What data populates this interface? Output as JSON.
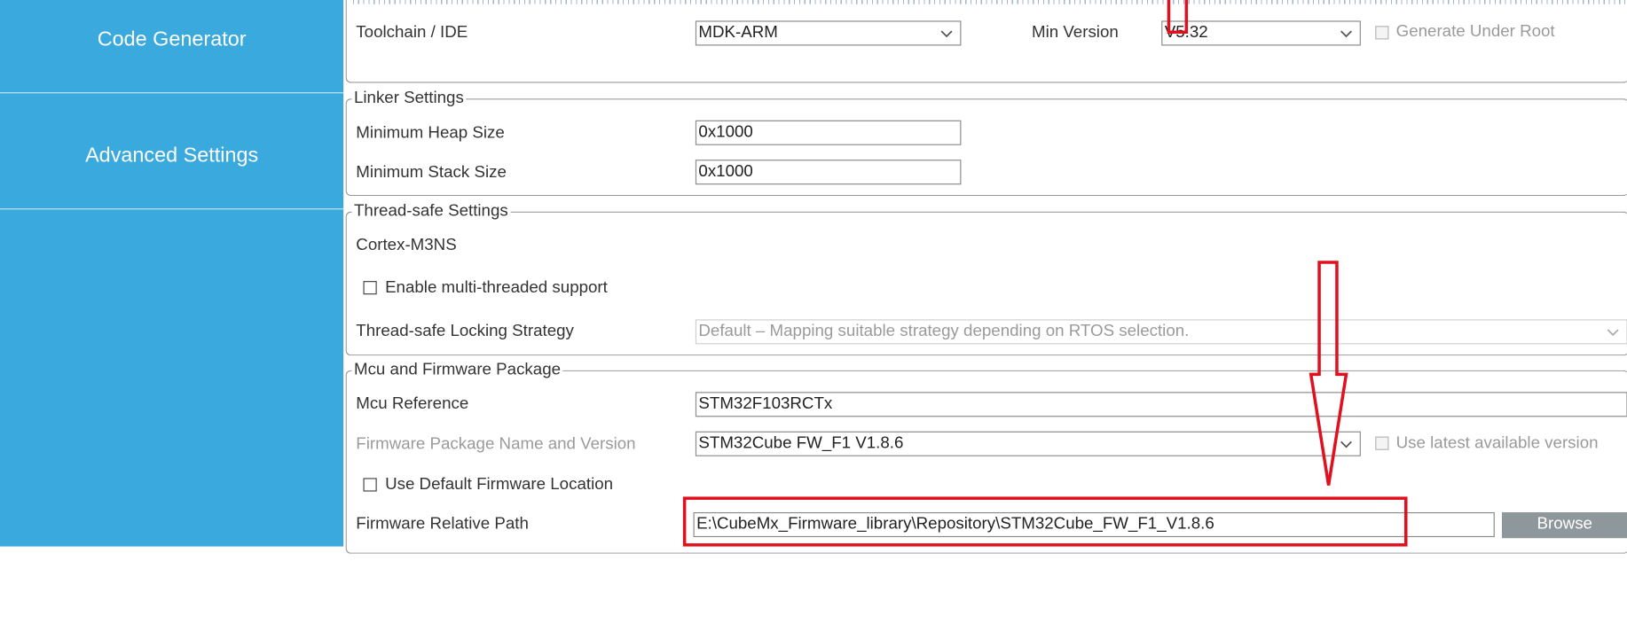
{
  "sidebar": {
    "items": [
      {
        "label": "Code Generator"
      },
      {
        "label": "Advanced Settings"
      }
    ]
  },
  "toolchain": {
    "label": "Toolchain / IDE",
    "value": "MDK-ARM",
    "min_version_label": "Min Version",
    "min_version_value": "V5.32",
    "generate_under_root_label": "Generate Under Root"
  },
  "linker": {
    "title": "Linker Settings",
    "heap_label": "Minimum Heap Size",
    "heap_value": "0x1000",
    "stack_label": "Minimum Stack Size",
    "stack_value": "0x1000"
  },
  "thread_safe": {
    "title": "Thread-safe Settings",
    "core": "Cortex-M3NS",
    "multithread_label": "Enable multi-threaded support",
    "strategy_label": "Thread-safe Locking Strategy",
    "strategy_value": "Default – Mapping suitable strategy depending on RTOS selection."
  },
  "mcu_fw": {
    "title": "Mcu and Firmware Package",
    "mcu_ref_label": "Mcu Reference",
    "mcu_ref_value": "STM32F103RCTx",
    "fw_pkg_label": "Firmware Package Name and Version",
    "fw_pkg_value": "STM32Cube FW_F1 V1.8.6",
    "use_latest_label": "Use latest available version",
    "use_default_loc_label": "Use Default Firmware Location",
    "fw_path_label": "Firmware Relative Path",
    "fw_path_value": "E:\\CubeMx_Firmware_library\\Repository\\STM32Cube_FW_F1_V1.8.6",
    "browse_label": "Browse"
  },
  "colors": {
    "sidebar": "#3aa9dd",
    "annotation": "#e0101e",
    "browse_button": "#8e979c"
  }
}
